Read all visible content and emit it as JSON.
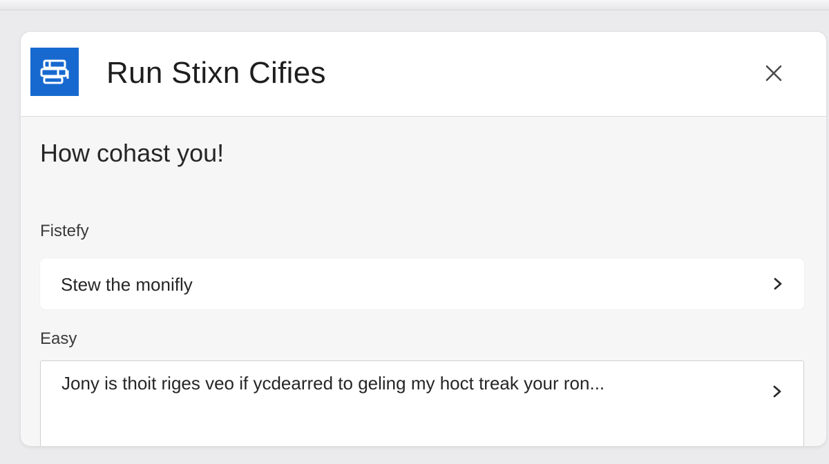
{
  "window": {
    "title": "Run Stixn Cifies",
    "icon": "app-logo-icon",
    "close_icon": "close-icon"
  },
  "content": {
    "prompt": "How cohast you!",
    "sections": [
      {
        "label": "Fistefy",
        "option_text": "Stew the monifly",
        "chevron_icon": "chevron-right-icon"
      },
      {
        "label": "Easy",
        "option_text": "Jony is thoit riges veo if ycdearred to geling my hoct treak your ron...",
        "chevron_icon": "chevron-right-icon"
      }
    ]
  },
  "colors": {
    "accent": "#1769cf",
    "window_bg": "#f6f6f6",
    "header_bg": "#ffffff",
    "page_bg": "#ebebed"
  }
}
